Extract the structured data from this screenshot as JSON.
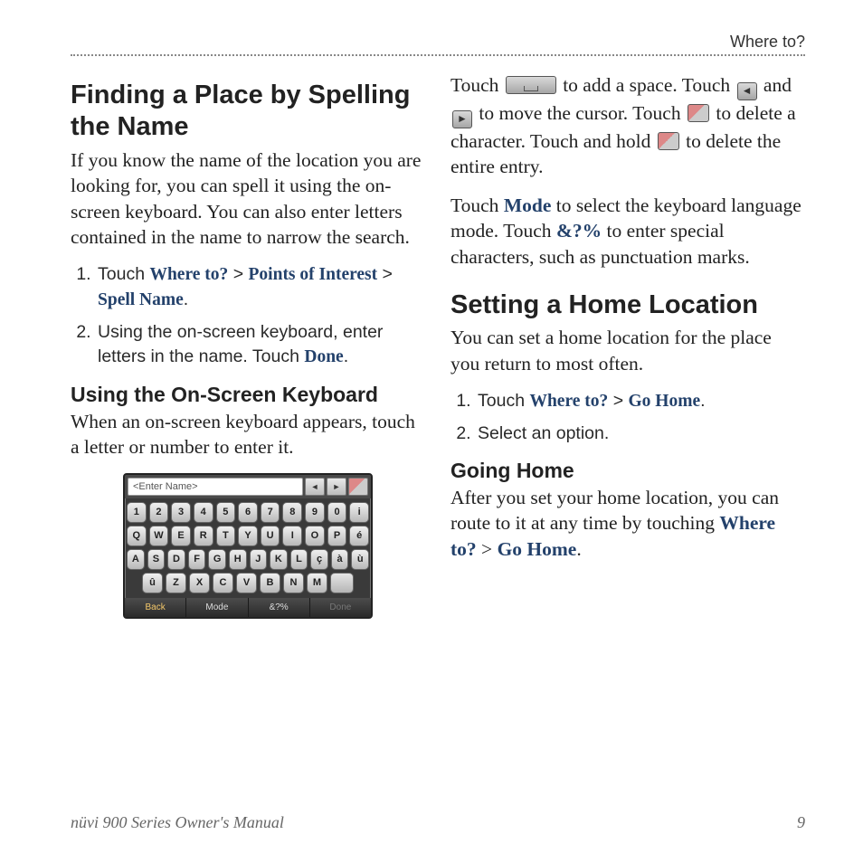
{
  "header": {
    "section": "Where to?"
  },
  "left": {
    "h1": "Finding a Place by Spelling the Name",
    "intro": "If you know the name of the location you are looking for, you can spell it using the on-screen keyboard. You can also enter letters contained in the name to narrow the search.",
    "step1_pre": "Touch ",
    "step1_l1": "Where to?",
    "step1_gt1": " > ",
    "step1_l2": "Points of Interest",
    "step1_gt2": " > ",
    "step1_l3": "Spell Name",
    "step1_post": ".",
    "step2_pre": "Using the on-screen keyboard, enter letters in the name. Touch ",
    "step2_l": "Done",
    "step2_post": ".",
    "sub": "Using the On-Screen Keyboard",
    "sub_body": "When an on-screen keyboard appears, touch a letter or number to enter it."
  },
  "right": {
    "para1_a": "Touch ",
    "para1_b": " to add a space. Touch ",
    "para1_c": " and ",
    "para1_d": " to move the cursor. Touch ",
    "para1_e": " to delete a character. Touch and hold ",
    "para1_f": " to delete the entire entry.",
    "para2_a": "Touch ",
    "para2_mode": "Mode",
    "para2_b": " to select the keyboard language mode. Touch ",
    "para2_sym": "&?%",
    "para2_c": " to enter special characters, such as punctuation marks.",
    "h1": "Setting a Home Location",
    "intro": "You can set a home location for the place you return to most often.",
    "step1_pre": "Touch ",
    "step1_l1": "Where to?",
    "step1_gt": " > ",
    "step1_l2": "Go Home",
    "step1_post": ".",
    "step2": "Select an option.",
    "sub": "Going Home",
    "sub_body_a": "After you set your home location, you can route to it at any time by touching ",
    "sub_body_l1": "Where to?",
    "sub_body_gt": " > ",
    "sub_body_l2": "Go Home",
    "sub_body_post": "."
  },
  "keyboard": {
    "placeholder": "<Enter Name>",
    "row1": [
      "1",
      "2",
      "3",
      "4",
      "5",
      "6",
      "7",
      "8",
      "9",
      "0",
      "i"
    ],
    "row2": [
      "Q",
      "W",
      "E",
      "R",
      "T",
      "Y",
      "U",
      "I",
      "O",
      "P",
      "é"
    ],
    "row3": [
      "A",
      "S",
      "D",
      "F",
      "G",
      "H",
      "J",
      "K",
      "L",
      "ç",
      "à",
      "ù"
    ],
    "row4": [
      "û",
      "Z",
      "X",
      "C",
      "V",
      "B",
      "N",
      "M",
      "␣"
    ],
    "bottom": {
      "back": "Back",
      "mode": "Mode",
      "sym": "&?%",
      "done": "Done"
    }
  },
  "footer": {
    "manual": "nüvi 900 Series Owner's Manual",
    "page": "9"
  }
}
